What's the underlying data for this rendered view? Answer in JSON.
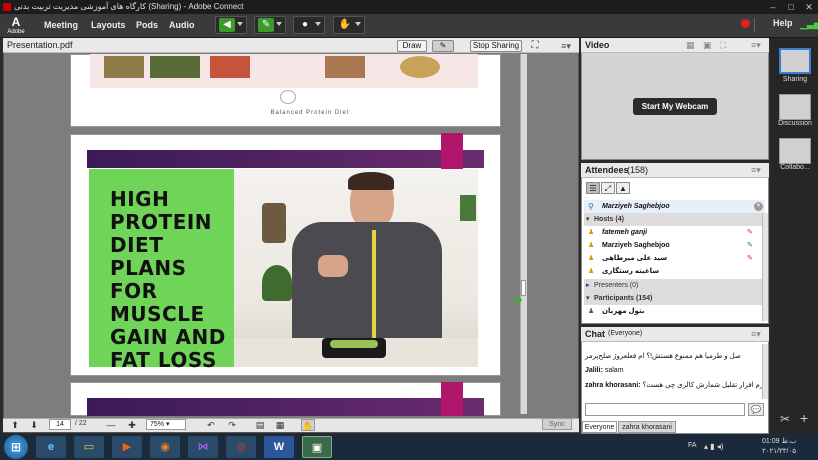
{
  "window": {
    "title": "کارگاه های آموزشی مدیریت تربیت بدنی (Sharing) - Adobe Connect"
  },
  "logo": {
    "letter": "A",
    "label": "Adobe"
  },
  "menu": [
    "Meeting",
    "Layouts",
    "Pods",
    "Audio"
  ],
  "help_label": "Help",
  "share_pod": {
    "title": "Presentation.pdf",
    "draw_label": "Draw",
    "stop_label": "Stop Sharing",
    "slide_top_caption": "Balanced Protein Diet",
    "headline": [
      "HIGH",
      "PROTEIN",
      "DIET PLANS",
      "FOR",
      "MUSCLE",
      "GAIN AND",
      "FAT LOSS"
    ],
    "page_current": "14",
    "page_total": "/ 22",
    "zoom": "75%",
    "sync_label": "Sync"
  },
  "video_pod": {
    "title": "Video",
    "webcam_label": "Start My Webcam"
  },
  "attendees_pod": {
    "title": "Attendees",
    "count": "(158)",
    "selected": "Marziyeh Saghebjoo",
    "hosts_label": "Hosts (4)",
    "hosts": [
      "fatemeh ganji",
      "Marziyeh Saghebjoo",
      "سید علی میرطاهی",
      "ساغینه رستگاری"
    ],
    "presenters_label": "Presenters (0)",
    "participants_label": "Participants (154)",
    "participants": [
      "بتول مهربان"
    ]
  },
  "chat_pod": {
    "title": "Chat",
    "scope": "(Everyone)",
    "messages": [
      {
        "author": "",
        "text": "صل و طرمیا هم ممنوع هستش!؟ ام فعلعروژ صلح‌پرمر"
      },
      {
        "author": "Jalili:",
        "text": "salam"
      },
      {
        "author": "zahra khorasani:",
        "text": "نرم افزار تقلیل شمارش کالری چی هست؟"
      }
    ],
    "tabs": [
      "Everyone",
      "zahra khorasani"
    ]
  },
  "layouts": [
    {
      "label": "Sharing"
    },
    {
      "label": "Discussion"
    },
    {
      "label": "Collabo..."
    }
  ],
  "taskbar": {
    "lang": "FA",
    "time": "01:09 ب.ظ",
    "date": "۲۰۲۱/۳۳/۰۵"
  },
  "colors": {
    "accent_green": "#6fd458",
    "slide_magenta": "#b0166c",
    "slide_purple": "#3a1b57",
    "record_red": "#e02020"
  }
}
